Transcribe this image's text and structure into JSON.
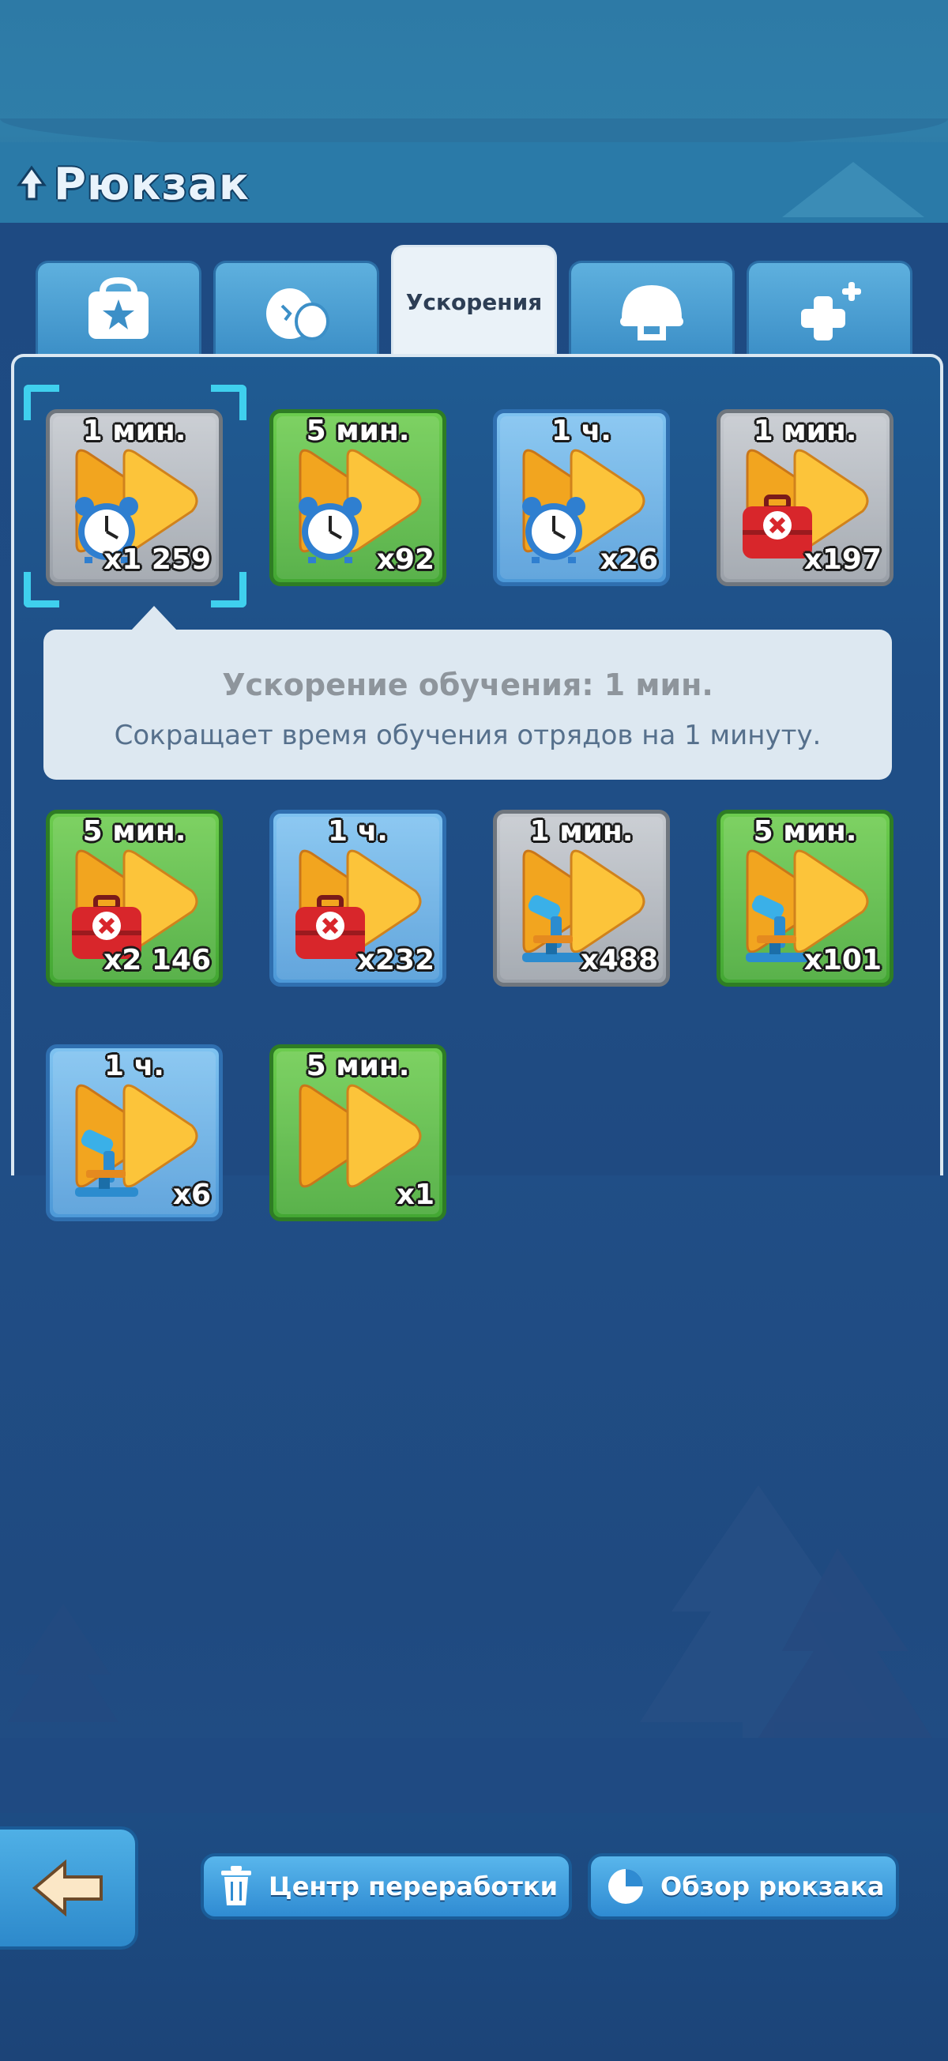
{
  "header": {
    "title": "Рюкзак"
  },
  "tabs": [
    {
      "name": "tab-resources",
      "label": "",
      "icon": "bag-icon",
      "active": false
    },
    {
      "name": "tab-eggs",
      "label": "",
      "icon": "egg-icon",
      "active": false
    },
    {
      "name": "tab-speedups",
      "label": "Ускорения",
      "icon": "",
      "active": true
    },
    {
      "name": "tab-equipment",
      "label": "",
      "icon": "helmet-icon",
      "active": false
    },
    {
      "name": "tab-buffs",
      "label": "",
      "icon": "plus-icon",
      "active": false
    }
  ],
  "items": [
    {
      "time": "1 мин.",
      "count": "x1 259",
      "rarity": "gray",
      "kind": "alarm-clock-icon"
    },
    {
      "time": "5 мин.",
      "count": "x92",
      "rarity": "green",
      "kind": "alarm-clock-icon"
    },
    {
      "time": "1 ч.",
      "count": "x26",
      "rarity": "blue",
      "kind": "alarm-clock-icon"
    },
    {
      "time": "1 мин.",
      "count": "x197",
      "rarity": "gray",
      "kind": "first-aid-kit-icon"
    },
    {
      "time": "5 мин.",
      "count": "x2 146",
      "rarity": "green",
      "kind": "first-aid-kit-icon"
    },
    {
      "time": "1 ч.",
      "count": "x232",
      "rarity": "blue",
      "kind": "first-aid-kit-icon"
    },
    {
      "time": "1 мин.",
      "count": "x488",
      "rarity": "gray",
      "kind": "microscope-icon"
    },
    {
      "time": "5 мин.",
      "count": "x101",
      "rarity": "green",
      "kind": "microscope-icon"
    },
    {
      "time": "1 ч.",
      "count": "x6",
      "rarity": "blue",
      "kind": "microscope-icon"
    },
    {
      "time": "5 мин.",
      "count": "x1",
      "rarity": "green",
      "kind": ""
    }
  ],
  "tooltip": {
    "title": "Ускорение обучения: 1 мин.",
    "description": "Сокращает время обучения отрядов на 1 минуту."
  },
  "footer": {
    "recycle_label": "Центр переработки",
    "overview_label": "Обзор рюкзака"
  },
  "colors": {
    "gray": "#9aa0a8",
    "green": "#43a733",
    "blue": "#4d99d8",
    "selection": "#3fd0ee",
    "arrow_orange": "#f5a623"
  }
}
